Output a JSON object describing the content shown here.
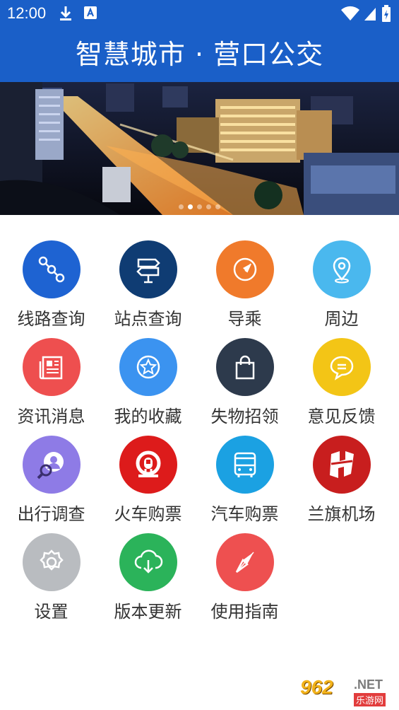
{
  "status_bar": {
    "time": "12:00"
  },
  "header": {
    "title": "智慧城市 · 营口公交"
  },
  "banner": {
    "dots": 5,
    "active_dot": 1
  },
  "menu": [
    {
      "label": "线路查询",
      "icon": "route-icon",
      "color": "#1e63d2"
    },
    {
      "label": "站点查询",
      "icon": "signpost-icon",
      "color": "#0f3c73"
    },
    {
      "label": "导乘",
      "icon": "navigation-icon",
      "color": "#f07a2b"
    },
    {
      "label": "周边",
      "icon": "location-pin-icon",
      "color": "#4ab8ee"
    },
    {
      "label": "资讯消息",
      "icon": "news-icon",
      "color": "#ee4f4f"
    },
    {
      "label": "我的收藏",
      "icon": "star-icon",
      "color": "#3b93f0"
    },
    {
      "label": "失物招领",
      "icon": "shopping-bag-icon",
      "color": "#2d3a4c"
    },
    {
      "label": "意见反馈",
      "icon": "chat-bubble-icon",
      "color": "#f3c516"
    },
    {
      "label": "出行调查",
      "icon": "survey-person-icon",
      "color": "#8e7be6"
    },
    {
      "label": "火车购票",
      "icon": "railway-logo-icon",
      "color": "#dd1b1b"
    },
    {
      "label": "汽车购票",
      "icon": "bus-icon",
      "color": "#1ba1e2"
    },
    {
      "label": "兰旗机场",
      "icon": "airport-logo-icon",
      "color": "#c81e1e"
    },
    {
      "label": "设置",
      "icon": "gear-icon",
      "color": "#b9bcc0"
    },
    {
      "label": "版本更新",
      "icon": "cloud-download-icon",
      "color": "#2bb35a"
    },
    {
      "label": "使用指南",
      "icon": "compass-icon",
      "color": "#ee5050"
    }
  ],
  "watermark": {
    "number": "962",
    "domain": ".NET",
    "site": "乐游网"
  }
}
